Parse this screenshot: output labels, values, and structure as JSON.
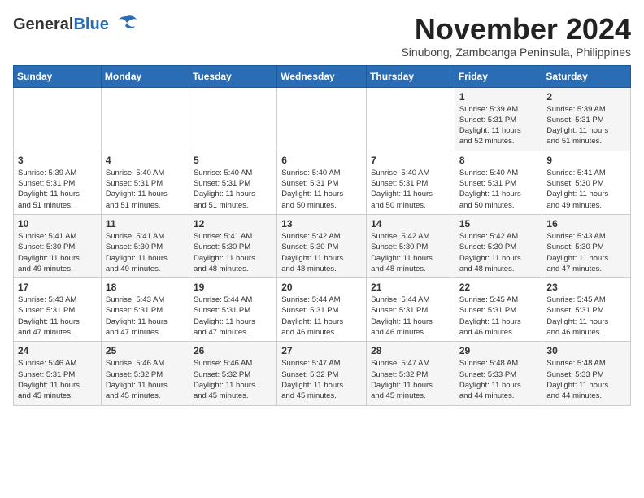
{
  "header": {
    "logo_general": "General",
    "logo_blue": "Blue",
    "month": "November 2024",
    "location": "Sinubong, Zamboanga Peninsula, Philippines"
  },
  "weekdays": [
    "Sunday",
    "Monday",
    "Tuesday",
    "Wednesday",
    "Thursday",
    "Friday",
    "Saturday"
  ],
  "weeks": [
    [
      {
        "day": "",
        "info": ""
      },
      {
        "day": "",
        "info": ""
      },
      {
        "day": "",
        "info": ""
      },
      {
        "day": "",
        "info": ""
      },
      {
        "day": "",
        "info": ""
      },
      {
        "day": "1",
        "info": "Sunrise: 5:39 AM\nSunset: 5:31 PM\nDaylight: 11 hours\nand 52 minutes."
      },
      {
        "day": "2",
        "info": "Sunrise: 5:39 AM\nSunset: 5:31 PM\nDaylight: 11 hours\nand 51 minutes."
      }
    ],
    [
      {
        "day": "3",
        "info": "Sunrise: 5:39 AM\nSunset: 5:31 PM\nDaylight: 11 hours\nand 51 minutes."
      },
      {
        "day": "4",
        "info": "Sunrise: 5:40 AM\nSunset: 5:31 PM\nDaylight: 11 hours\nand 51 minutes."
      },
      {
        "day": "5",
        "info": "Sunrise: 5:40 AM\nSunset: 5:31 PM\nDaylight: 11 hours\nand 51 minutes."
      },
      {
        "day": "6",
        "info": "Sunrise: 5:40 AM\nSunset: 5:31 PM\nDaylight: 11 hours\nand 50 minutes."
      },
      {
        "day": "7",
        "info": "Sunrise: 5:40 AM\nSunset: 5:31 PM\nDaylight: 11 hours\nand 50 minutes."
      },
      {
        "day": "8",
        "info": "Sunrise: 5:40 AM\nSunset: 5:31 PM\nDaylight: 11 hours\nand 50 minutes."
      },
      {
        "day": "9",
        "info": "Sunrise: 5:41 AM\nSunset: 5:30 PM\nDaylight: 11 hours\nand 49 minutes."
      }
    ],
    [
      {
        "day": "10",
        "info": "Sunrise: 5:41 AM\nSunset: 5:30 PM\nDaylight: 11 hours\nand 49 minutes."
      },
      {
        "day": "11",
        "info": "Sunrise: 5:41 AM\nSunset: 5:30 PM\nDaylight: 11 hours\nand 49 minutes."
      },
      {
        "day": "12",
        "info": "Sunrise: 5:41 AM\nSunset: 5:30 PM\nDaylight: 11 hours\nand 48 minutes."
      },
      {
        "day": "13",
        "info": "Sunrise: 5:42 AM\nSunset: 5:30 PM\nDaylight: 11 hours\nand 48 minutes."
      },
      {
        "day": "14",
        "info": "Sunrise: 5:42 AM\nSunset: 5:30 PM\nDaylight: 11 hours\nand 48 minutes."
      },
      {
        "day": "15",
        "info": "Sunrise: 5:42 AM\nSunset: 5:30 PM\nDaylight: 11 hours\nand 48 minutes."
      },
      {
        "day": "16",
        "info": "Sunrise: 5:43 AM\nSunset: 5:30 PM\nDaylight: 11 hours\nand 47 minutes."
      }
    ],
    [
      {
        "day": "17",
        "info": "Sunrise: 5:43 AM\nSunset: 5:31 PM\nDaylight: 11 hours\nand 47 minutes."
      },
      {
        "day": "18",
        "info": "Sunrise: 5:43 AM\nSunset: 5:31 PM\nDaylight: 11 hours\nand 47 minutes."
      },
      {
        "day": "19",
        "info": "Sunrise: 5:44 AM\nSunset: 5:31 PM\nDaylight: 11 hours\nand 47 minutes."
      },
      {
        "day": "20",
        "info": "Sunrise: 5:44 AM\nSunset: 5:31 PM\nDaylight: 11 hours\nand 46 minutes."
      },
      {
        "day": "21",
        "info": "Sunrise: 5:44 AM\nSunset: 5:31 PM\nDaylight: 11 hours\nand 46 minutes."
      },
      {
        "day": "22",
        "info": "Sunrise: 5:45 AM\nSunset: 5:31 PM\nDaylight: 11 hours\nand 46 minutes."
      },
      {
        "day": "23",
        "info": "Sunrise: 5:45 AM\nSunset: 5:31 PM\nDaylight: 11 hours\nand 46 minutes."
      }
    ],
    [
      {
        "day": "24",
        "info": "Sunrise: 5:46 AM\nSunset: 5:31 PM\nDaylight: 11 hours\nand 45 minutes."
      },
      {
        "day": "25",
        "info": "Sunrise: 5:46 AM\nSunset: 5:32 PM\nDaylight: 11 hours\nand 45 minutes."
      },
      {
        "day": "26",
        "info": "Sunrise: 5:46 AM\nSunset: 5:32 PM\nDaylight: 11 hours\nand 45 minutes."
      },
      {
        "day": "27",
        "info": "Sunrise: 5:47 AM\nSunset: 5:32 PM\nDaylight: 11 hours\nand 45 minutes."
      },
      {
        "day": "28",
        "info": "Sunrise: 5:47 AM\nSunset: 5:32 PM\nDaylight: 11 hours\nand 45 minutes."
      },
      {
        "day": "29",
        "info": "Sunrise: 5:48 AM\nSunset: 5:33 PM\nDaylight: 11 hours\nand 44 minutes."
      },
      {
        "day": "30",
        "info": "Sunrise: 5:48 AM\nSunset: 5:33 PM\nDaylight: 11 hours\nand 44 minutes."
      }
    ]
  ]
}
